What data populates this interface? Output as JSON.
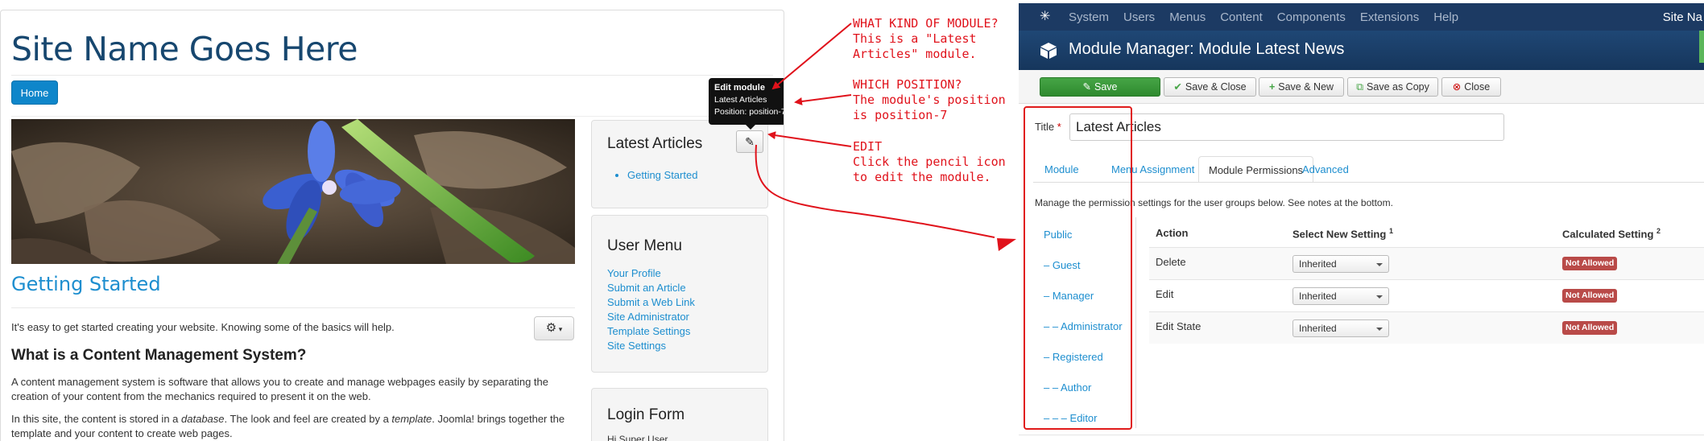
{
  "frontend": {
    "site_name": "Site Name Goes Here",
    "nav": {
      "home": "Home"
    },
    "article": {
      "title": "Getting Started",
      "intro": "It's easy to get started creating your website. Knowing some of the basics will help.",
      "heading": "What is a Content Management System?",
      "para1": "A content management system is software that allows you to create and manage webpages easily by separating the creation of your content from the mechanics required to present it on the web.",
      "para2_a": "In this site, the content is stored in a ",
      "para2_em1": "database",
      "para2_b": ". The look and feel are created by a ",
      "para2_em2": "template",
      "para2_c": ". Joomla! brings together the template and your content to create web pages."
    },
    "modules": {
      "latest": {
        "title": "Latest Articles",
        "items": [
          "Getting Started"
        ]
      },
      "user_menu": {
        "title": "User Menu",
        "links": [
          "Your Profile",
          "Submit an Article",
          "Submit a Web Link",
          "Site Administrator",
          "Template Settings",
          "Site Settings"
        ]
      },
      "login": {
        "title": "Login Form",
        "greeting": "Hi Super User,"
      }
    },
    "tooltip": {
      "heading": "Edit module",
      "module": "Latest Articles",
      "position": "Position: position-7"
    }
  },
  "annotations": {
    "what_kind": "WHAT KIND OF MODULE?\nThis is a \"Latest\nArticles\" module.",
    "which_position": "WHICH POSITION?\nThe module's position\nis position-7",
    "edit": "EDIT\nClick the pencil icon\nto edit the module."
  },
  "admin": {
    "menu": [
      "System",
      "Users",
      "Menus",
      "Content",
      "Components",
      "Extensions",
      "Help"
    ],
    "site_name_partial": "Site Na",
    "page_title": "Module Manager: Module Latest News",
    "toolbar": {
      "save": "Save",
      "save_close": "Save & Close",
      "save_new": "Save & New",
      "save_copy": "Save as Copy",
      "close": "Close"
    },
    "title_label": "Title",
    "required_mark": "*",
    "title_value": "Latest Articles",
    "tabs": [
      "Module",
      "Menu Assignment",
      "Module Permissions",
      "Advanced"
    ],
    "active_tab": "Module Permissions",
    "manage_note": "Manage the permission settings for the user groups below. See notes at the bottom.",
    "groups": [
      "Public",
      "– Guest",
      "– Manager",
      "– – Administrator",
      "– Registered",
      "– – Author",
      "– – – Editor"
    ],
    "permissions": {
      "headers": {
        "action": "Action",
        "select": "Select New Setting",
        "select_note": "1",
        "calculated": "Calculated Setting",
        "calculated_note": "2"
      },
      "rows": [
        {
          "action": "Delete",
          "setting": "Inherited",
          "calculated": "Not Allowed"
        },
        {
          "action": "Edit",
          "setting": "Inherited",
          "calculated": "Not Allowed"
        },
        {
          "action": "Edit State",
          "setting": "Inherited",
          "calculated": "Not Allowed"
        }
      ]
    }
  },
  "colors": {
    "annotation_red": "#e0121b",
    "joomla_blue": "#1c3a63",
    "link_blue": "#1d8ecf",
    "save_green": "#46a546",
    "not_allowed_red": "#b94a48"
  }
}
